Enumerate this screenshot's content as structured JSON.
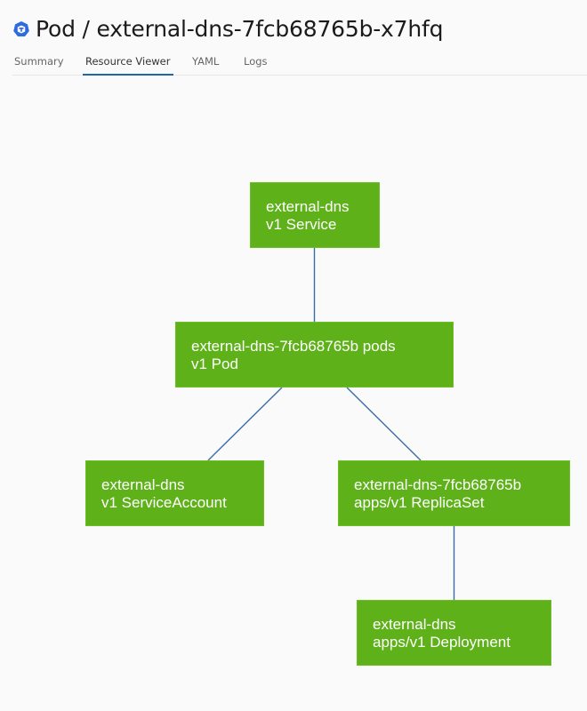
{
  "header": {
    "icon": "kubernetes-pod-icon",
    "title": "Pod / external-dns-7fcb68765b-x7hfq"
  },
  "tabs": [
    {
      "label": "Summary",
      "active": false
    },
    {
      "label": "Resource Viewer",
      "active": true
    },
    {
      "label": "YAML",
      "active": false
    },
    {
      "label": "Logs",
      "active": false
    }
  ],
  "colors": {
    "node_fill": "#5fb11a",
    "edge": "#3a6ea5",
    "active_tab_underline": "#1e64ad",
    "icon_blue": "#2e6ae0",
    "background": "#fafafa"
  },
  "graph": {
    "nodes": [
      {
        "id": "service",
        "name": "external-dns",
        "kind": "v1 Service"
      },
      {
        "id": "pod",
        "name": "external-dns-7fcb68765b pods",
        "kind": "v1 Pod"
      },
      {
        "id": "sa",
        "name": "external-dns",
        "kind": "v1 ServiceAccount"
      },
      {
        "id": "rs",
        "name": "external-dns-7fcb68765b",
        "kind": "apps/v1 ReplicaSet"
      },
      {
        "id": "deploy",
        "name": "external-dns",
        "kind": "apps/v1 Deployment"
      }
    ],
    "edges": [
      {
        "from": "service",
        "to": "pod"
      },
      {
        "from": "pod",
        "to": "sa"
      },
      {
        "from": "pod",
        "to": "rs"
      },
      {
        "from": "rs",
        "to": "deploy"
      }
    ]
  }
}
